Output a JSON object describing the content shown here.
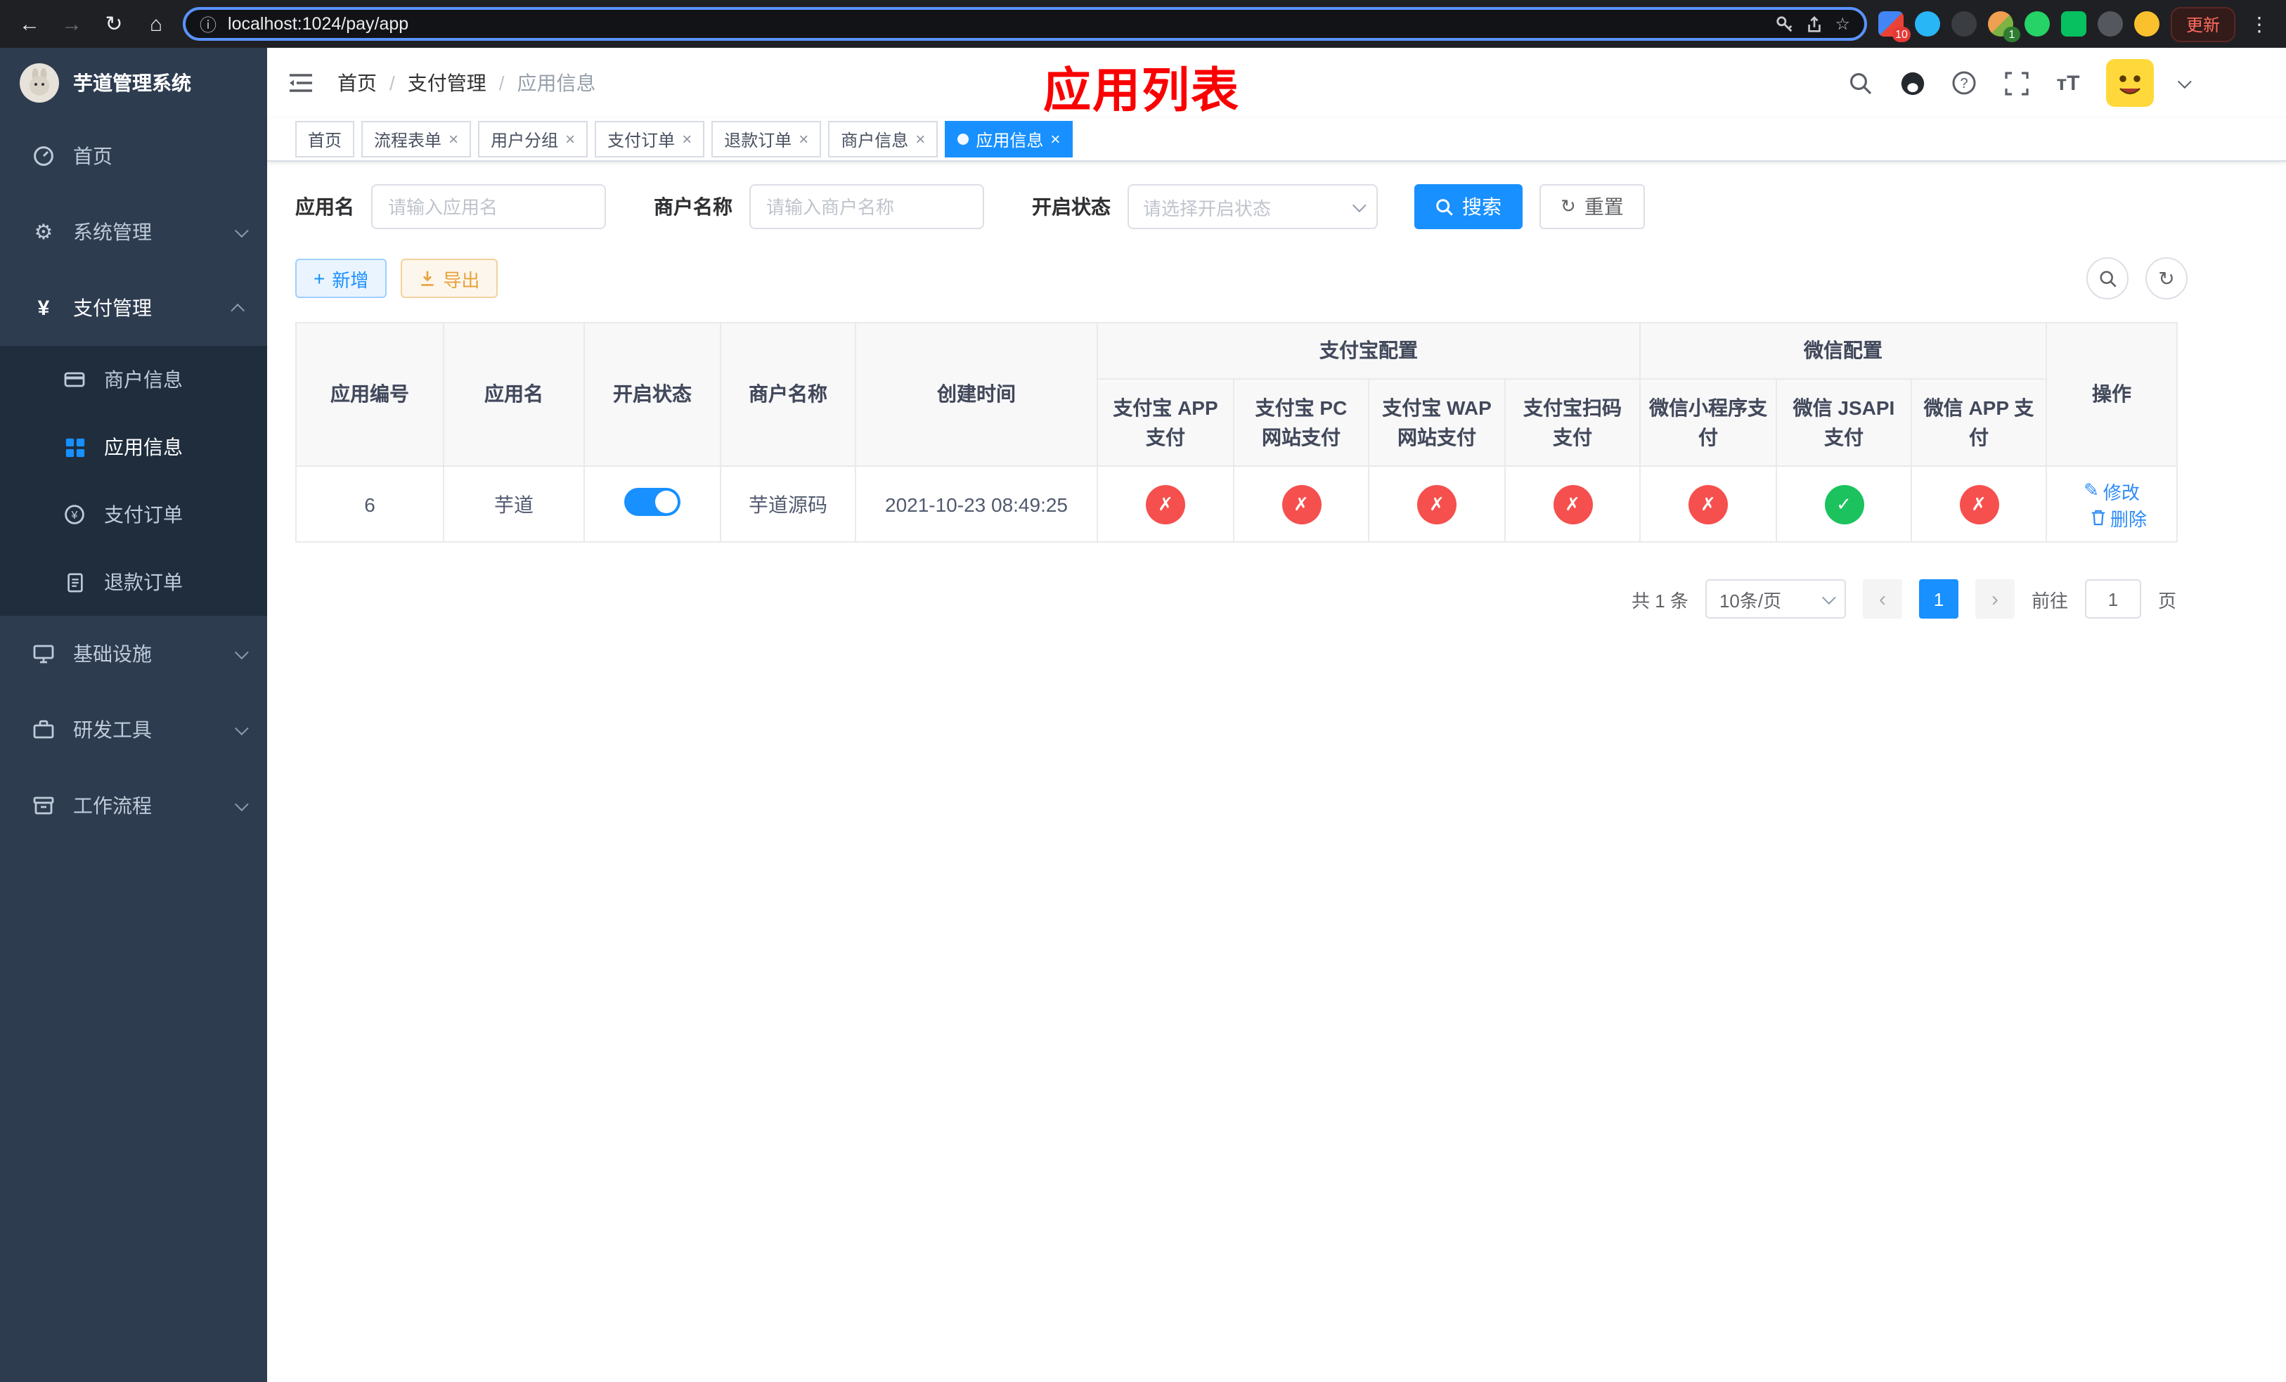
{
  "colors": {
    "accent": "#1890ff",
    "sidebar_bg": "#2e3c50",
    "sidebar_child_bg": "#1f2d3d",
    "danger_circle": "#f5504e",
    "success_circle": "#1cc25e",
    "annotation_red": "#fb0000"
  },
  "browser": {
    "url": "localhost:1024/pay/app",
    "update_button": "更新",
    "ext_badge_grid": "10",
    "ext_badge_avatar": "1"
  },
  "sidebar": {
    "app_title": "芋道管理系统",
    "menu": {
      "home": "首页",
      "system": "系统管理",
      "payment": "支付管理",
      "merchant": "商户信息",
      "appinfo": "应用信息",
      "order": "支付订单",
      "refund": "退款订单",
      "infra": "基础设施",
      "dev": "研发工具",
      "workflow": "工作流程"
    }
  },
  "header": {
    "breadcrumb": [
      "首页",
      "支付管理",
      "应用信息"
    ],
    "annotation": "应用列表"
  },
  "tabs": [
    {
      "label": "首页"
    },
    {
      "label": "流程表单"
    },
    {
      "label": "用户分组"
    },
    {
      "label": "支付订单"
    },
    {
      "label": "退款订单"
    },
    {
      "label": "商户信息"
    },
    {
      "label": "应用信息"
    }
  ],
  "filters": {
    "name_label": "应用名",
    "name_placeholder": "请输入应用名",
    "merchant_label": "商户名称",
    "merchant_placeholder": "请输入商户名称",
    "status_label": "开启状态",
    "status_placeholder": "请选择开启状态",
    "search": "搜索",
    "reset": "重置"
  },
  "toolbar": {
    "add": "新增",
    "export": "导出"
  },
  "table": {
    "group_headers": {
      "alipay": "支付宝配置",
      "wechat": "微信配置"
    },
    "columns": {
      "app_id": "应用编号",
      "app_name": "应用名",
      "status": "开启状态",
      "merchant_name": "商户名称",
      "create_time": "创建时间",
      "alipay_app": "支付宝 APP 支付",
      "alipay_pc": "支付宝 PC 网站支付",
      "alipay_wap": "支付宝 WAP 网站支付",
      "alipay_qr": "支付宝扫码支付",
      "wx_mini": "微信小程序支付",
      "wx_jsapi": "微信 JSAPI 支付",
      "wx_app": "微信 APP 支付",
      "actions": "操作"
    },
    "rows": [
      {
        "app_id": "6",
        "app_name": "芋道",
        "enabled": true,
        "merchant_name": "芋道源码",
        "create_time": "2021-10-23 08:49:25",
        "alipay_app": false,
        "alipay_pc": false,
        "alipay_wap": false,
        "alipay_qr": false,
        "wx_mini": false,
        "wx_jsapi": true,
        "wx_app": false,
        "edit_label": "修改",
        "delete_label": "删除"
      }
    ]
  },
  "pagination": {
    "total": "共 1 条",
    "page_size": "10条/页",
    "page": "1",
    "goto_prefix": "前往",
    "goto_value": "1",
    "goto_suffix": "页"
  }
}
